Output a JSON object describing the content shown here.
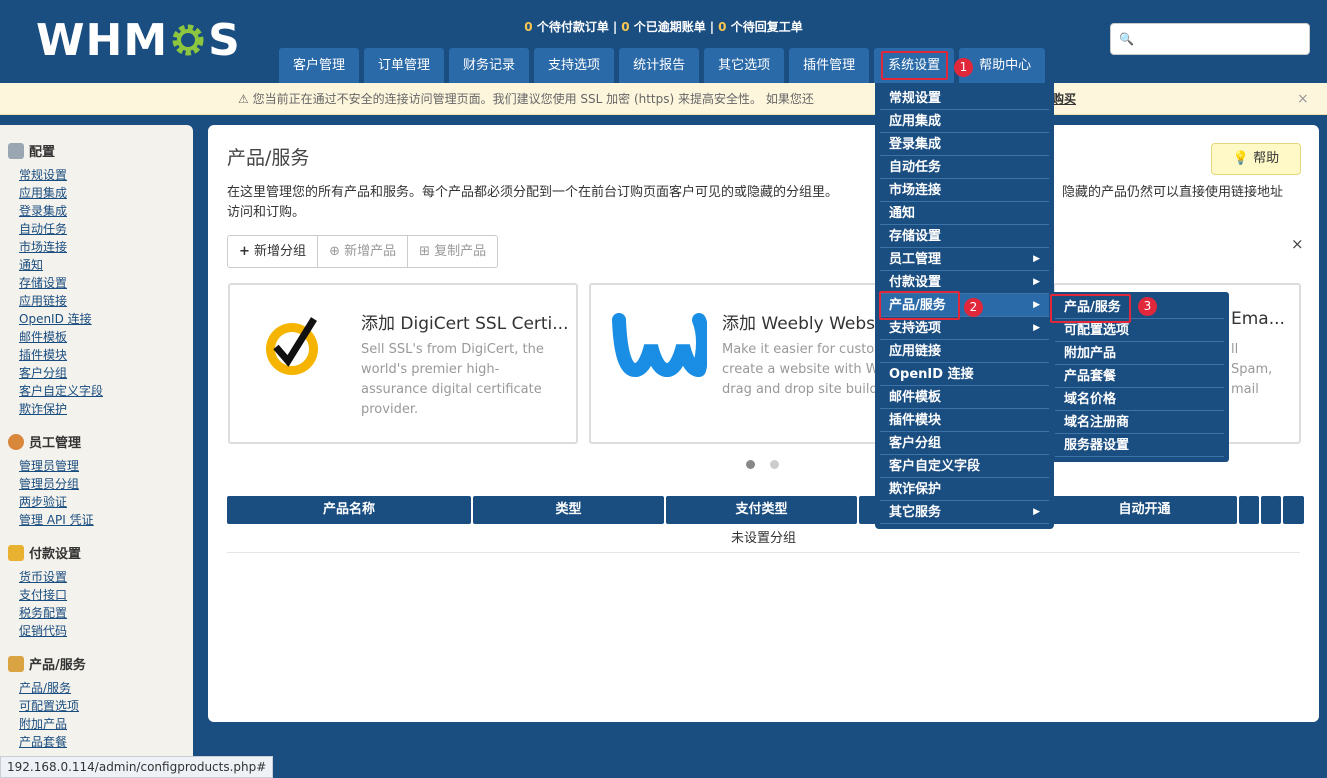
{
  "header": {
    "logo_prefix": "WHM",
    "logo_suffix": "S",
    "stats": [
      {
        "num": "0",
        "label": " 个待付款订单"
      },
      {
        "num": "0",
        "label": " 个已逾期账单"
      },
      {
        "num": "0",
        "label": " 个待回复工单"
      }
    ],
    "search_placeholder": "",
    "nav": [
      "客户管理",
      "订单管理",
      "财务记录",
      "支持选项",
      "统计报告",
      "其它选项",
      "插件管理",
      "系统设置",
      "帮助中心"
    ]
  },
  "warning": {
    "text": "⚠ 您当前正在通过不安全的连接访问管理页面。我们建议您使用 SSL 加密 (https) 来提高安全性。 如果您还",
    "buy": "购买",
    "close": "×"
  },
  "sidebar": {
    "sections": [
      {
        "title": "配置",
        "icon": "config-icon",
        "color": "#9aa6b2",
        "links": [
          "常规设置",
          "应用集成",
          "登录集成",
          "自动任务",
          "市场连接",
          "通知",
          "存储设置",
          "应用链接",
          "OpenID 连接",
          "邮件模板",
          "插件模块",
          "客户分组",
          "客户自定义字段",
          "欺诈保护"
        ]
      },
      {
        "title": "员工管理",
        "icon": "staff-icon",
        "color": "#d9873a",
        "links": [
          "管理员管理",
          "管理员分组",
          "两步验证",
          "管理 API 凭证"
        ]
      },
      {
        "title": "付款设置",
        "icon": "payment-icon",
        "color": "#e8b230",
        "links": [
          "货币设置",
          "支付接口",
          "税务配置",
          "促销代码"
        ]
      },
      {
        "title": "产品/服务",
        "icon": "product-icon",
        "color": "#d9a441",
        "links": [
          "产品/服务",
          "可配置选项",
          "附加产品",
          "产品套餐"
        ]
      }
    ]
  },
  "main": {
    "title": "产品/服务",
    "help": "帮助",
    "desc_line1": "在这里管理您的所有产品和服务。每个产品都必须分配到一个在前台订购页面客户可见的或隐藏的分组里。",
    "desc_tail": "隐藏的产品仍然可以直接使用链接地址",
    "desc_line2": "访问和订购。",
    "buttons": [
      "新增分组",
      "新增产品",
      "复制产品"
    ],
    "dismiss": "×",
    "promos": [
      {
        "title": "添加 DigiCert SSL Certi...",
        "desc": [
          "Sell SSL's from DigiCert, the",
          "world's premier high-",
          "assurance digital certificate",
          "provider."
        ]
      },
      {
        "title": "添加 Weebly Websit",
        "desc": [
          "Make it easier for custom",
          "create a website with We",
          "drag and drop site build"
        ]
      },
      {
        "title": "Ema...",
        "desc": [
          "ll",
          "Spam,",
          "mail"
        ]
      }
    ],
    "table_headers": [
      "产品名称",
      "类型",
      "支付类型",
      "",
      "自动开通",
      "",
      "",
      ""
    ],
    "empty_text": "未设置分组"
  },
  "dropdown": {
    "items": [
      {
        "label": "常规设置",
        "arrow": ""
      },
      {
        "label": "应用集成",
        "arrow": ""
      },
      {
        "label": "登录集成",
        "arrow": ""
      },
      {
        "label": "自动任务",
        "arrow": ""
      },
      {
        "label": "市场连接",
        "arrow": ""
      },
      {
        "label": "通知",
        "arrow": ""
      },
      {
        "label": "存储设置",
        "arrow": ""
      },
      {
        "label": "员工管理",
        "arrow": "▶"
      },
      {
        "label": "付款设置",
        "arrow": "▶"
      },
      {
        "label": "产品/服务",
        "arrow": "▶"
      },
      {
        "label": "支持选项",
        "arrow": "▶"
      },
      {
        "label": "应用链接",
        "arrow": ""
      },
      {
        "label": "OpenID 连接",
        "arrow": ""
      },
      {
        "label": "邮件模板",
        "arrow": ""
      },
      {
        "label": "插件模块",
        "arrow": ""
      },
      {
        "label": "客户分组",
        "arrow": ""
      },
      {
        "label": "客户自定义字段",
        "arrow": ""
      },
      {
        "label": "欺诈保护",
        "arrow": ""
      },
      {
        "label": "其它服务",
        "arrow": "▶"
      }
    ]
  },
  "submenu": {
    "items": [
      "产品/服务",
      "可配置选项",
      "附加产品",
      "产品套餐",
      "域名价格",
      "域名注册商",
      "服务器设置"
    ]
  },
  "badges": [
    "1",
    "2",
    "3"
  ],
  "statusbar": "192.168.0.114/admin/configproducts.php#"
}
